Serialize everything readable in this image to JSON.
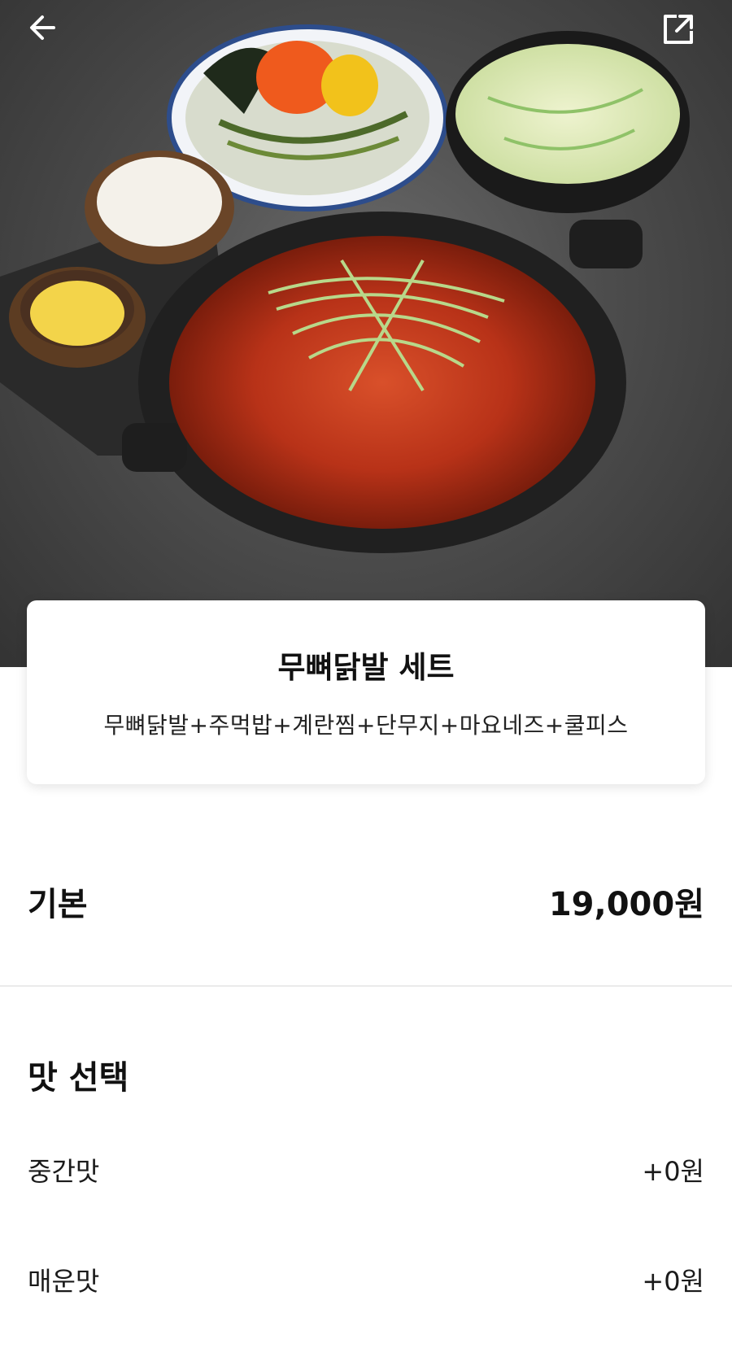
{
  "header": {
    "back_icon": "arrow-left-icon",
    "share_icon": "external-link-icon"
  },
  "product": {
    "name": "무뼈닭발 세트",
    "description": "무뼈닭발+주먹밥+계란찜+단무지+마요네즈+쿨피스"
  },
  "base": {
    "label": "기본",
    "price": "19,000원"
  },
  "flavor_section": {
    "title": "맛 선택",
    "options": [
      {
        "label": "중간맛",
        "price": "+0원"
      },
      {
        "label": "매운맛",
        "price": "+0원"
      }
    ]
  },
  "colors": {
    "background": "#ffffff",
    "text": "#111111",
    "divider": "#ebebeb"
  }
}
